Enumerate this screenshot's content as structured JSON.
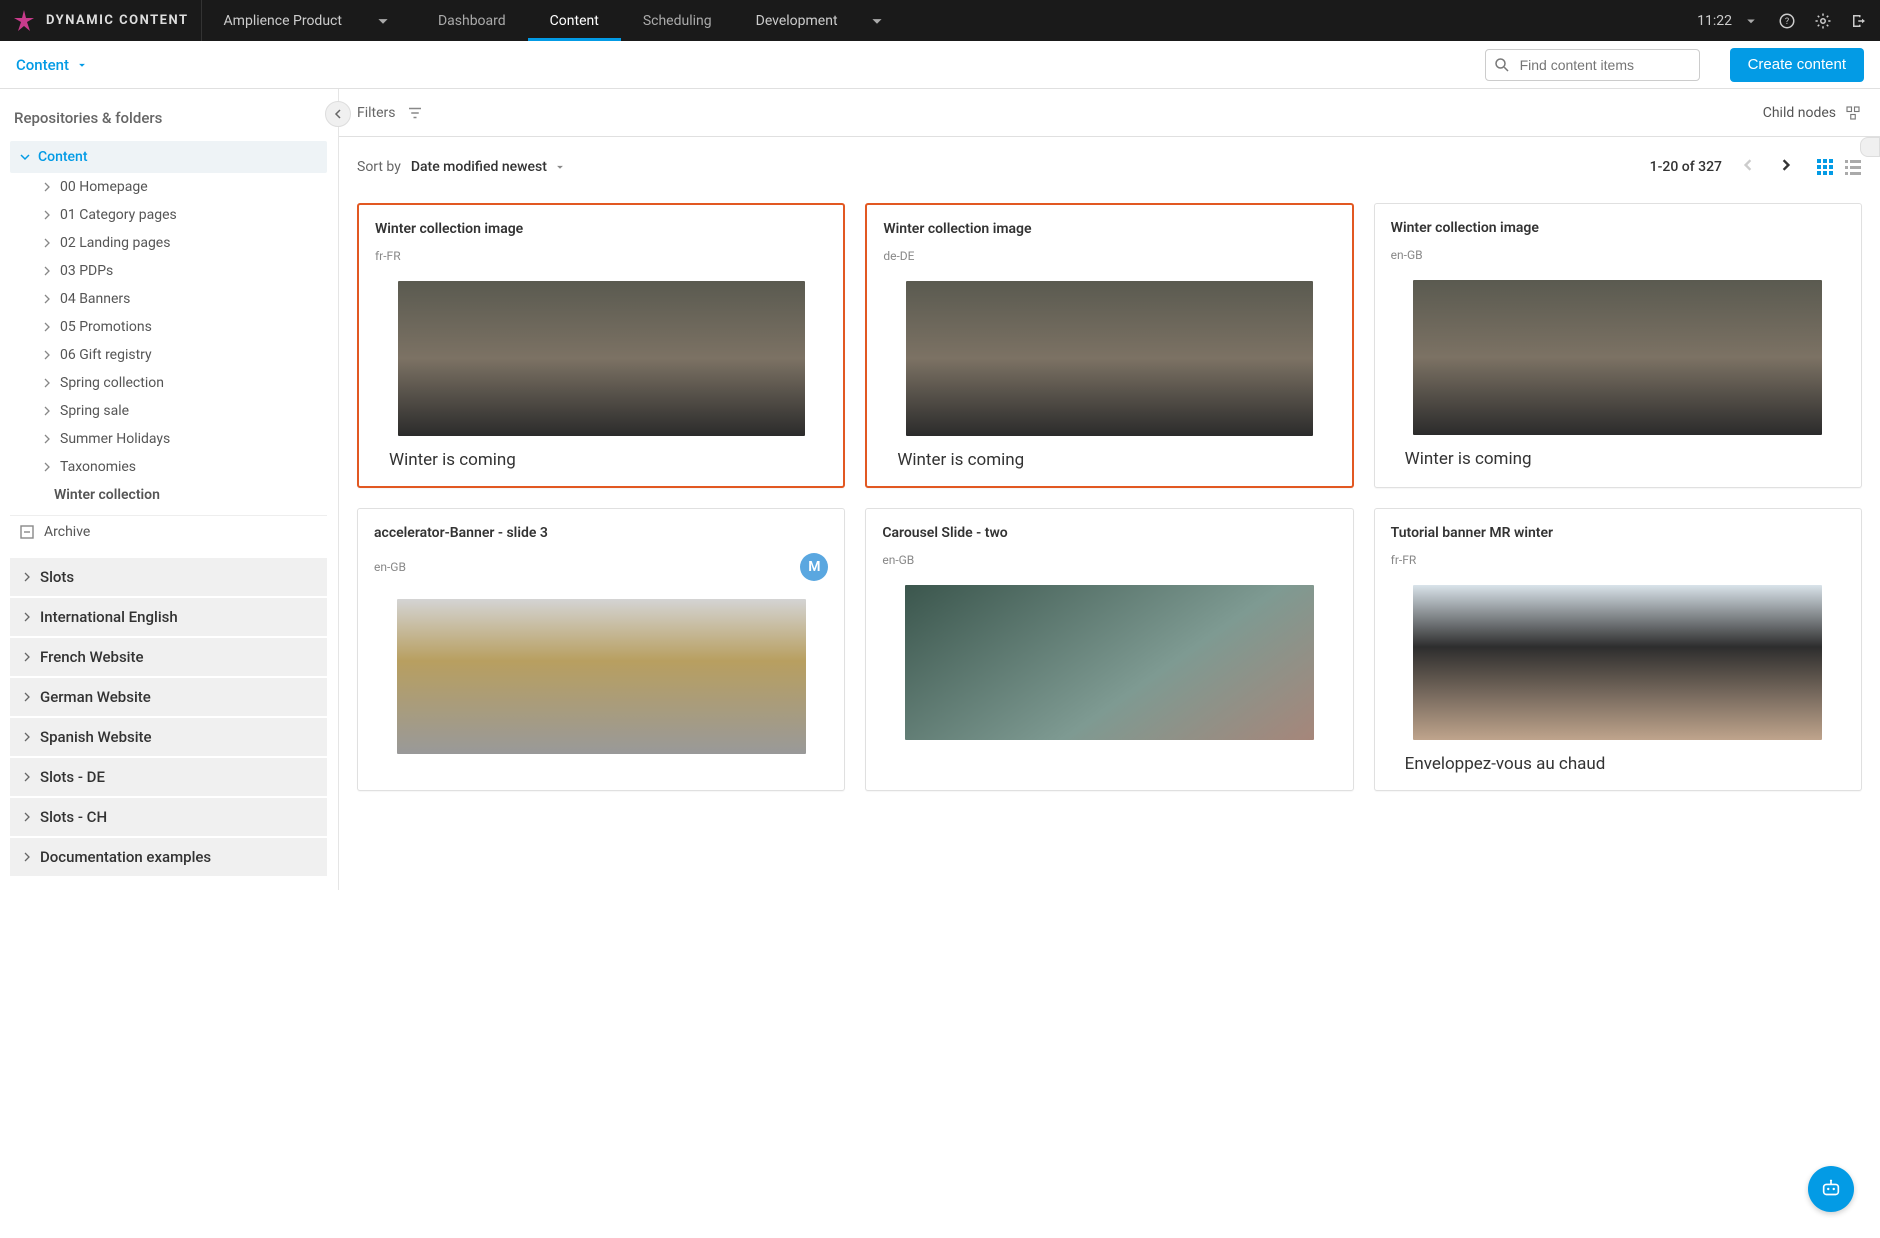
{
  "header": {
    "logo_text": "DYNAMIC CONTENT",
    "product": "Amplience Product",
    "tabs": [
      "Dashboard",
      "Content",
      "Scheduling"
    ],
    "active_tab": 1,
    "environment": "Development",
    "time": "11:22"
  },
  "subheader": {
    "dropdown_label": "Content",
    "search_placeholder": "Find content items",
    "create_button": "Create content"
  },
  "sidebar": {
    "heading": "Repositories & folders",
    "root": "Content",
    "folders": [
      "00 Homepage",
      "01 Category pages",
      "02 Landing pages",
      "03 PDPs",
      "04 Banners",
      "05 Promotions",
      "06 Gift registry",
      "Spring collection",
      "Spring sale",
      "Summer Holidays",
      "Taxonomies",
      "Winter collection"
    ],
    "selected_folder": "Winter collection",
    "archive": "Archive",
    "repos": [
      "Slots",
      "International English",
      "French Website",
      "German Website",
      "Spanish Website",
      "Slots - DE",
      "Slots - CH",
      "Documentation examples"
    ]
  },
  "toolbar": {
    "filters_label": "Filters",
    "child_nodes_label": "Child nodes",
    "sort_label": "Sort by",
    "sort_value": "Date modified newest",
    "range": "1-20 of 327"
  },
  "cards": [
    {
      "title": "Winter collection image",
      "locale": "fr-FR",
      "caption": "Winter is coming",
      "highlight": true,
      "img": "ph1",
      "avatar": ""
    },
    {
      "title": "Winter collection image",
      "locale": "de-DE",
      "caption": "Winter is coming",
      "highlight": true,
      "img": "ph1",
      "avatar": ""
    },
    {
      "title": "Winter collection image",
      "locale": "en-GB",
      "caption": "Winter is coming",
      "highlight": false,
      "img": "ph1",
      "avatar": ""
    },
    {
      "title": "accelerator-Banner - slide 3",
      "locale": "en-GB",
      "caption": "",
      "highlight": false,
      "img": "ph2",
      "avatar": "M"
    },
    {
      "title": "Carousel Slide - two",
      "locale": "en-GB",
      "caption": "",
      "highlight": false,
      "img": "ph3",
      "avatar": ""
    },
    {
      "title": "Tutorial banner MR winter",
      "locale": "fr-FR",
      "caption": "Enveloppez-vous au chaud",
      "highlight": false,
      "img": "ph4",
      "avatar": ""
    }
  ]
}
